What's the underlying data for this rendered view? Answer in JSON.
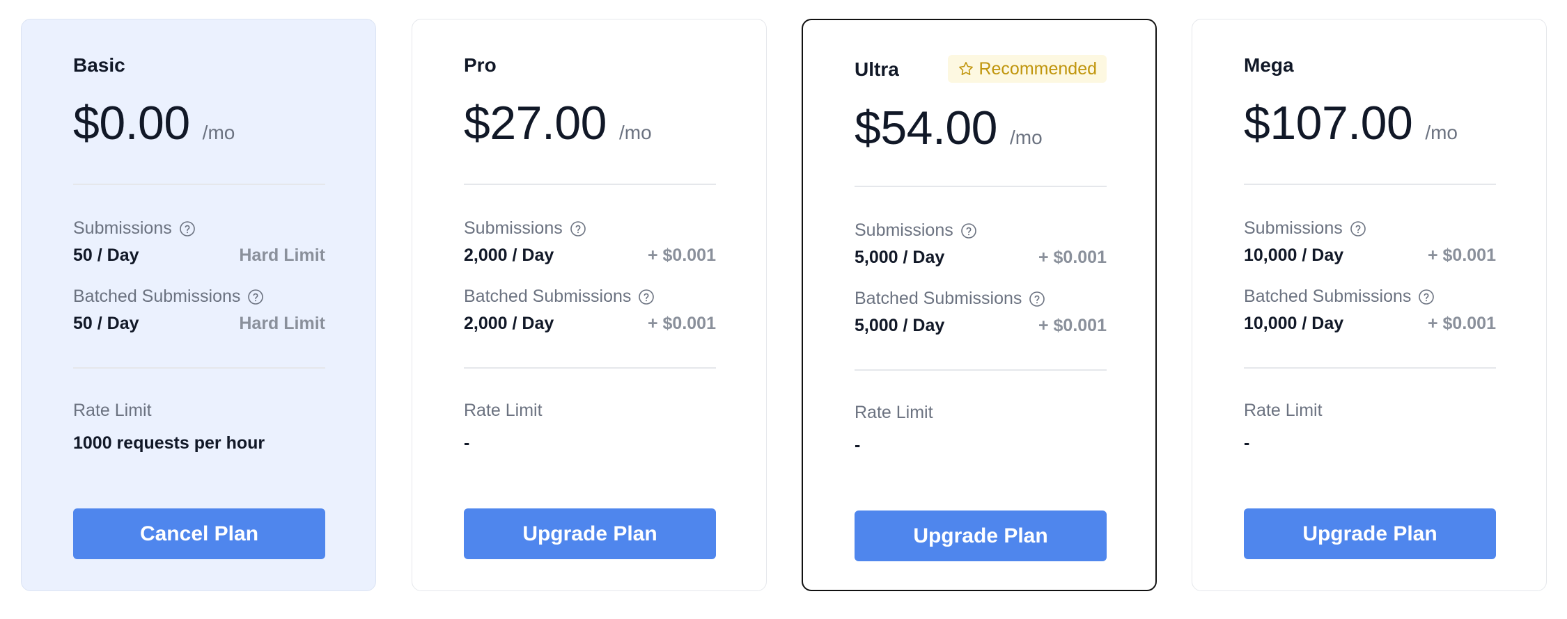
{
  "plans": [
    {
      "name": "Basic",
      "badge": "",
      "price": "$0.00",
      "period": "/mo",
      "submissions_label": "Submissions",
      "submissions_value": "50 / Day",
      "submissions_extra": "Hard Limit",
      "batched_label": "Batched Submissions",
      "batched_value": "50 / Day",
      "batched_extra": "Hard Limit",
      "rate_label": "Rate Limit",
      "rate_value": "1000 requests per hour",
      "cta": "Cancel Plan"
    },
    {
      "name": "Pro",
      "badge": "",
      "price": "$27.00",
      "period": "/mo",
      "submissions_label": "Submissions",
      "submissions_value": "2,000 / Day",
      "submissions_extra": "+ $0.001",
      "batched_label": "Batched Submissions",
      "batched_value": "2,000 / Day",
      "batched_extra": "+ $0.001",
      "rate_label": "Rate Limit",
      "rate_value": "-",
      "cta": "Upgrade Plan"
    },
    {
      "name": "Ultra",
      "badge": "Recommended",
      "price": "$54.00",
      "period": "/mo",
      "submissions_label": "Submissions",
      "submissions_value": "5,000 / Day",
      "submissions_extra": "+ $0.001",
      "batched_label": "Batched Submissions",
      "batched_value": "5,000 / Day",
      "batched_extra": "+ $0.001",
      "rate_label": "Rate Limit",
      "rate_value": "-",
      "cta": "Upgrade Plan"
    },
    {
      "name": "Mega",
      "badge": "",
      "price": "$107.00",
      "period": "/mo",
      "submissions_label": "Submissions",
      "submissions_value": "10,000 / Day",
      "submissions_extra": "+ $0.001",
      "batched_label": "Batched Submissions",
      "batched_value": "10,000 / Day",
      "batched_extra": "+ $0.001",
      "rate_label": "Rate Limit",
      "rate_value": "-",
      "cta": "Upgrade Plan"
    }
  ],
  "icons": {
    "help": "help-circle-icon",
    "badge": "star-icon"
  },
  "colors": {
    "accent": "#4f86ed",
    "current_plan_bg": "#ebf1fe",
    "badge_bg": "#fdf8e1",
    "badge_text": "#c0950c",
    "muted_text": "#6b7280"
  }
}
